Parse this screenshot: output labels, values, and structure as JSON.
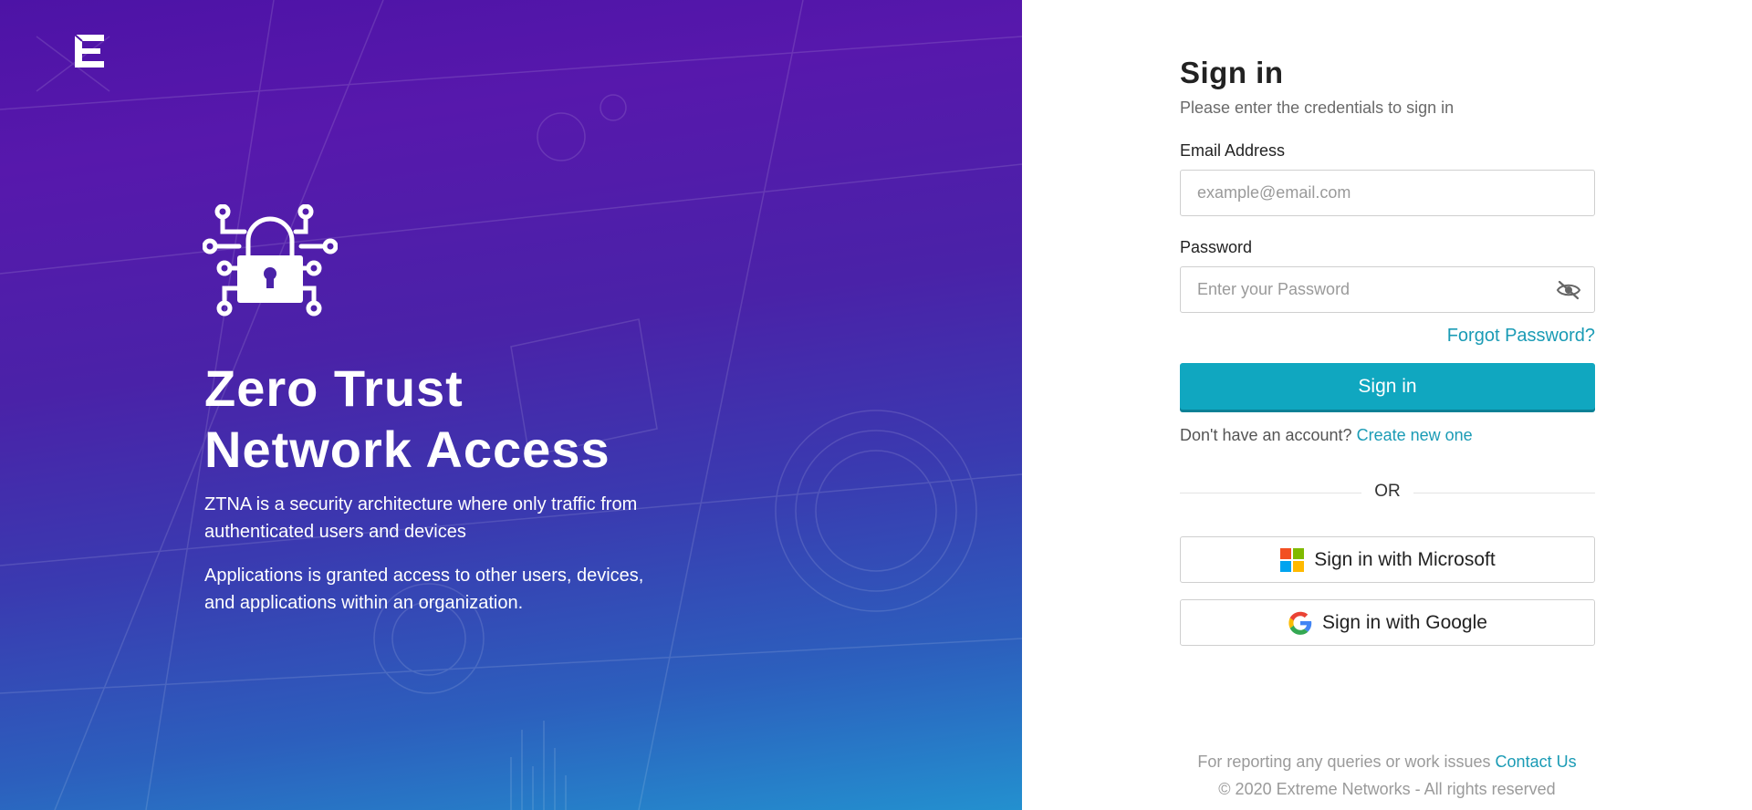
{
  "hero": {
    "title_line1": "Zero Trust",
    "title_line2": "Network Access",
    "desc1": "ZTNA is a security architecture where only traffic from authenticated users and devices",
    "desc2": "Applications is granted access to other users, devices, and applications within an organization.",
    "logo_icon": "extreme-networks-logo",
    "lock_icon": "circuit-lock-icon"
  },
  "signin": {
    "title": "Sign in",
    "subtitle": "Please enter the credentials to sign in",
    "email_label": "Email Address",
    "email_placeholder": "example@email.com",
    "email_value": "",
    "password_label": "Password",
    "password_placeholder": "Enter your Password",
    "password_value": "",
    "forgot": "Forgot Password?",
    "submit": "Sign in",
    "no_account": "Don't have an account?",
    "create": "Create new one",
    "or": "OR",
    "microsoft": "Sign in with Microsoft",
    "google": "Sign in with Google"
  },
  "footer": {
    "report": "For reporting any queries or work issues",
    "contact": "Contact Us",
    "copyright": "© 2020 Extreme Networks - All rights reserved"
  },
  "colors": {
    "accent": "#10a7c0",
    "link": "#1a9bb5",
    "hero_top": "#4d13a6",
    "hero_bottom": "#2390cf"
  }
}
